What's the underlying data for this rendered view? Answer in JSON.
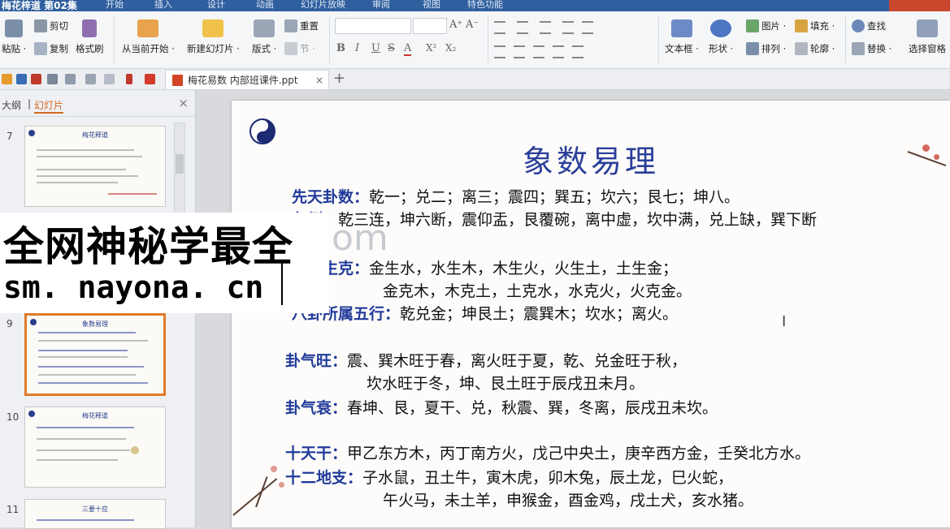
{
  "window": {
    "title": "梅花梓道 第02集",
    "menus": [
      "开始",
      "插入",
      "设计",
      "动画",
      "幻灯片放映",
      "审阅",
      "视图",
      "特色功能"
    ]
  },
  "ribbon": {
    "paste": "粘贴 ·",
    "cut": "剪切",
    "copy": "复制",
    "format_painter": "格式刷",
    "play_from_current": "从当前开始 ·",
    "new_slide": "新建幻灯片 ·",
    "layout": "版式 ·",
    "reset": "重置",
    "section": "节 ·",
    "textbox": "文本框 ·",
    "shape": "形状 ·",
    "picture": "图片 ·",
    "fill": "填充 ·",
    "arrange": "排列 ·",
    "outline": "轮廓 ·",
    "find": "查找",
    "replace": "替换 ·",
    "select_pane": "选择窗格",
    "font_buttons": [
      "B",
      "I",
      "U",
      "S",
      "A",
      "X²",
      "X₂"
    ]
  },
  "doc_tab": {
    "filename": "梅花易数 内部班课件.ppt",
    "close": "×",
    "add": "+"
  },
  "panel": {
    "tab_outline": "大纲",
    "tab_slides": "幻灯片",
    "close": "×"
  },
  "thumbnails": [
    {
      "num": "7",
      "title": "梅花释道"
    },
    {
      "num": "9",
      "title": "象数易理"
    },
    {
      "num": "10",
      "title": "梅花释道"
    },
    {
      "num": "11",
      "title": "三要十应"
    }
  ],
  "watermark": {
    "line1": "全网神秘学最全",
    "line2": "sm. nayona. cn",
    "ghost": "om"
  },
  "slide": {
    "title": "象数易理",
    "rows": [
      {
        "label": "先天卦数：",
        "text": "乾一；兑二；离三；震四；巽五；坎六；艮七；坤八。"
      },
      {
        "label": "象例：",
        "text": "乾三连，坤六断，震仰盂，艮覆碗，离中虚，坎中满，兑上缺，巽下断"
      },
      {
        "label": "五行生克：",
        "text": "金生水，水生木，木生火，火生土，土生金；"
      },
      {
        "label": "",
        "text": "金克木，木克土，土克水，水克火，火克金。"
      },
      {
        "label": "八卦所属五行：",
        "text": "乾兑金；坤艮土；震巽木；坎水；离火。"
      },
      {
        "label": "卦气旺：",
        "text": "震、巽木旺于春，离火旺于夏，乾、兑金旺于秋，"
      },
      {
        "label": "",
        "text": "坎水旺于冬，坤、艮土旺于辰戌丑未月。"
      },
      {
        "label": "卦气衰：",
        "text": "春坤、艮，夏干、兑，秋震、巽，冬离，辰戌丑未坎。"
      },
      {
        "label": "十天干：",
        "text": "甲乙东方木，丙丁南方火，戊己中央土，庚辛西方金，壬癸北方水。"
      },
      {
        "label": "十二地支：",
        "text": "子水鼠，丑土牛，寅木虎，卯木兔，辰土龙，巳火蛇，"
      },
      {
        "label": "",
        "text": "午火马，未土羊，申猴金，酉金鸡，戌土犬，亥水猪。"
      }
    ]
  }
}
